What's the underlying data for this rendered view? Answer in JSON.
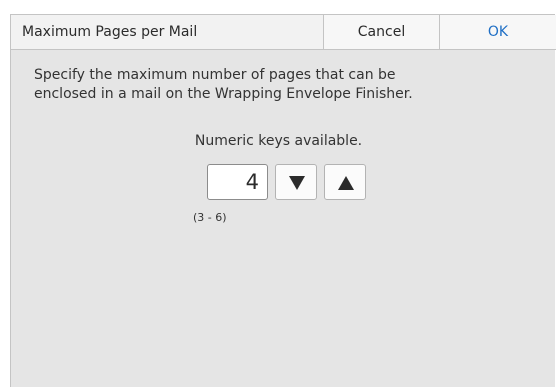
{
  "dialog": {
    "title": "Maximum Pages per Mail",
    "cancel_label": "Cancel",
    "ok_label": "OK"
  },
  "content": {
    "description_line1": "Specify the maximum number of pages that can be",
    "description_line2": "enclosed in a mail on the Wrapping Envelope Finisher.",
    "numeric_note": "Numeric keys available.",
    "value": "4",
    "range": "(3 - 6)"
  },
  "icons": {
    "decrement": "triangle-down-icon",
    "increment": "triangle-up-icon"
  },
  "colors": {
    "ok_text": "#1f6fc5",
    "panel_background": "#e5e5e5",
    "header_background": "#f2f2f2"
  }
}
